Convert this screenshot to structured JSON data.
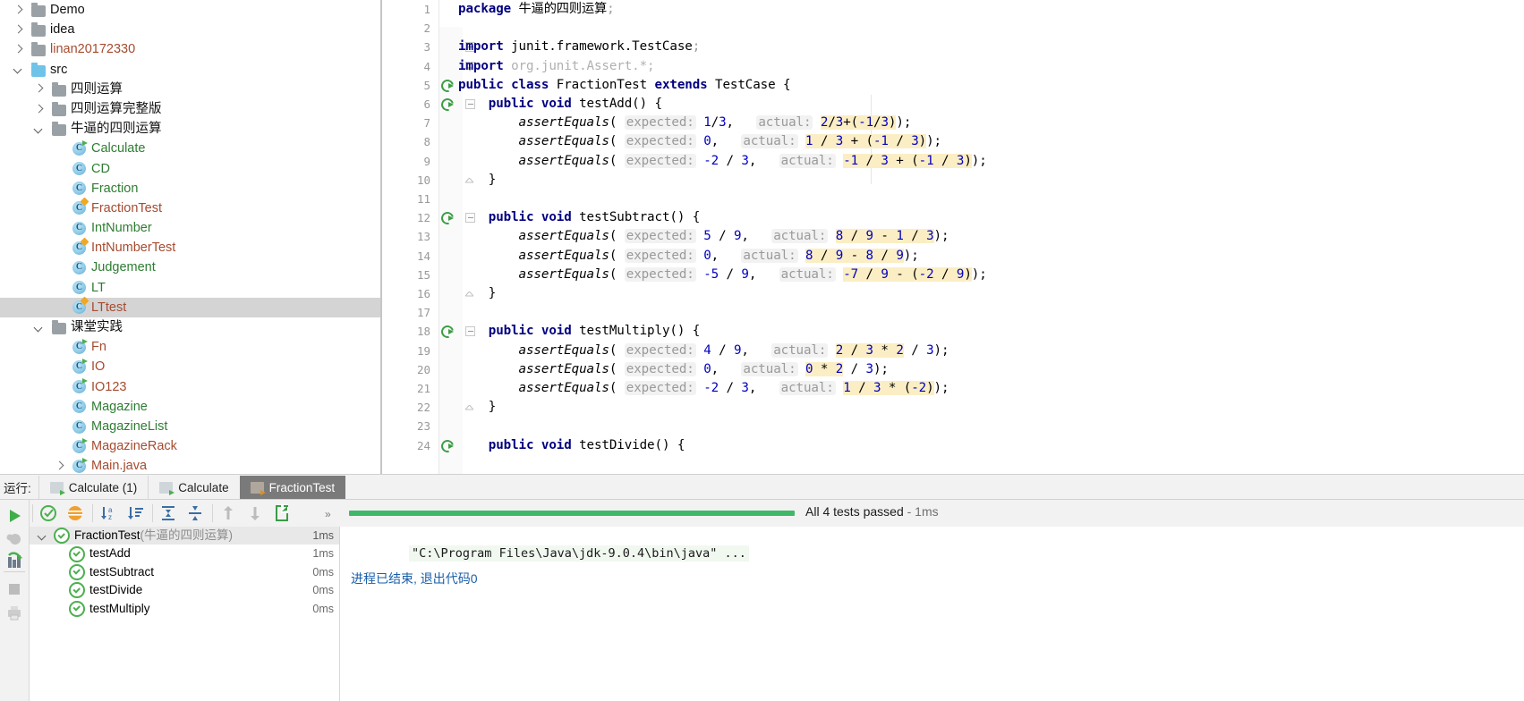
{
  "project_tree": {
    "rows": [
      {
        "indent": 0,
        "twisty": "right",
        "kind": "folder",
        "folder_style": "dark",
        "label": "Demo",
        "color": "black"
      },
      {
        "indent": 0,
        "twisty": "right",
        "kind": "folder",
        "folder_style": "dark",
        "label": "idea",
        "color": "black"
      },
      {
        "indent": 0,
        "twisty": "right",
        "kind": "folder",
        "folder_style": "dark",
        "label": "linan20172330",
        "color": "rust"
      },
      {
        "indent": 0,
        "twisty": "down",
        "kind": "folder",
        "folder_style": "blue",
        "label": "src",
        "color": "black"
      },
      {
        "indent": 1,
        "twisty": "right",
        "kind": "folder",
        "folder_style": "dark",
        "label": "四则运算",
        "color": "black"
      },
      {
        "indent": 1,
        "twisty": "right",
        "kind": "folder",
        "folder_style": "dark",
        "label": "四则运算完整版",
        "color": "black"
      },
      {
        "indent": 1,
        "twisty": "down",
        "kind": "folder",
        "folder_style": "dark",
        "label": "牛逼的四则运算",
        "color": "black"
      },
      {
        "indent": 2,
        "twisty": "none",
        "kind": "class",
        "icon": "class-runnable-icon",
        "label": "Calculate",
        "color": "green"
      },
      {
        "indent": 2,
        "twisty": "none",
        "kind": "class",
        "icon": "class-icon",
        "label": "CD",
        "color": "green"
      },
      {
        "indent": 2,
        "twisty": "none",
        "kind": "class",
        "icon": "class-icon",
        "label": "Fraction",
        "color": "green"
      },
      {
        "indent": 2,
        "twisty": "none",
        "kind": "class",
        "icon": "class-test-icon",
        "label": "FractionTest",
        "color": "rust"
      },
      {
        "indent": 2,
        "twisty": "none",
        "kind": "class",
        "icon": "class-icon",
        "label": "IntNumber",
        "color": "green"
      },
      {
        "indent": 2,
        "twisty": "none",
        "kind": "class",
        "icon": "class-test-icon",
        "label": "IntNumberTest",
        "color": "rust"
      },
      {
        "indent": 2,
        "twisty": "none",
        "kind": "class",
        "icon": "class-icon",
        "label": "Judgement",
        "color": "green"
      },
      {
        "indent": 2,
        "twisty": "none",
        "kind": "class",
        "icon": "class-icon",
        "label": "LT",
        "color": "green"
      },
      {
        "indent": 2,
        "twisty": "none",
        "kind": "class",
        "icon": "class-test-icon",
        "label": "LTtest",
        "color": "rust",
        "selected": true
      },
      {
        "indent": 1,
        "twisty": "down",
        "kind": "folder",
        "folder_style": "dark",
        "label": "课堂实践",
        "color": "black"
      },
      {
        "indent": 2,
        "twisty": "none",
        "kind": "class",
        "icon": "class-runnable-icon",
        "label": "Fn",
        "color": "rust"
      },
      {
        "indent": 2,
        "twisty": "none",
        "kind": "class",
        "icon": "class-runnable-icon",
        "label": "IO",
        "color": "rust"
      },
      {
        "indent": 2,
        "twisty": "none",
        "kind": "class",
        "icon": "class-runnable-icon",
        "label": "IO123",
        "color": "rust"
      },
      {
        "indent": 2,
        "twisty": "none",
        "kind": "class",
        "icon": "class-icon",
        "label": "Magazine",
        "color": "green"
      },
      {
        "indent": 2,
        "twisty": "none",
        "kind": "class",
        "icon": "class-icon",
        "label": "MagazineList",
        "color": "green"
      },
      {
        "indent": 2,
        "twisty": "none",
        "kind": "class",
        "icon": "class-runnable-icon",
        "label": "MagazineRack",
        "color": "rust"
      },
      {
        "indent": 2,
        "twisty": "right",
        "kind": "class",
        "icon": "class-runnable-icon",
        "label": "Main.java",
        "color": "rust"
      }
    ]
  },
  "editor": {
    "lines": [
      {
        "n": "1",
        "html": "<span class=\"kw\">package</span> 牛逼的四则运算<span class=\"gray\">;</span>"
      },
      {
        "n": "2",
        "html": ""
      },
      {
        "n": "3",
        "html": "<span class=\"kw\">import</span> junit.framework.TestCase<span class=\"gray\">;</span>",
        "fold": "top"
      },
      {
        "n": "4",
        "html": "<span class=\"kw\">import</span> <span class=\"faded\">org.junit.Assert.*;</span>",
        "fold": "tail"
      },
      {
        "n": "5",
        "html": "<span class=\"kw\">public class</span> FractionTest <span class=\"kw\">extends</span> TestCase {",
        "run": true
      },
      {
        "n": "6",
        "html": "    <span class=\"kw\">public void</span> testAdd() {",
        "run": true,
        "fold": "top"
      },
      {
        "n": "7",
        "html": "        <span class=\"italic\">assertEquals</span>( <span class=\"param-hint\">expected:</span> <span class=\"num\">1</span>/<span class=\"num\">3</span>,   <span class=\"param-hint\">actual:</span> <span class=\"hl\"><span class=\"num\">2</span>/<span class=\"num\">3</span>+(<span class=\"num\">-1</span>/<span class=\"num\">3</span>)</span>);"
      },
      {
        "n": "8",
        "html": "        <span class=\"italic\">assertEquals</span>( <span class=\"param-hint\">expected:</span> <span class=\"num\">0</span>,   <span class=\"param-hint\">actual:</span> <span class=\"hl\"><span class=\"num\">1</span> / <span class=\"num\">3</span> + (<span class=\"num\">-1</span> / <span class=\"num\">3</span>)</span>);"
      },
      {
        "n": "9",
        "html": "        <span class=\"italic\">assertEquals</span>( <span class=\"param-hint\">expected:</span> <span class=\"num\">-2</span> / <span class=\"num\">3</span>,   <span class=\"param-hint\">actual:</span> <span class=\"hl\"><span class=\"num\">-1</span> / <span class=\"num\">3</span> + (<span class=\"num\">-1</span> / <span class=\"num\">3</span>)</span>);"
      },
      {
        "n": "10",
        "html": "    }",
        "fold": "end"
      },
      {
        "n": "11",
        "html": ""
      },
      {
        "n": "12",
        "html": "    <span class=\"kw\">public void</span> testSubtract() {",
        "run": true,
        "fold": "top"
      },
      {
        "n": "13",
        "html": "        <span class=\"italic\">assertEquals</span>( <span class=\"param-hint\">expected:</span> <span class=\"num\">5</span> / <span class=\"num\">9</span>,   <span class=\"param-hint\">actual:</span> <span class=\"hl\"><span class=\"num\">8</span> / <span class=\"num\">9</span> - <span class=\"num\">1</span> / <span class=\"num\">3</span></span>);"
      },
      {
        "n": "14",
        "html": "        <span class=\"italic\">assertEquals</span>( <span class=\"param-hint\">expected:</span> <span class=\"num\">0</span>,   <span class=\"param-hint\">actual:</span> <span class=\"hl\"><span class=\"num\">8</span> / <span class=\"num\">9</span> - <span class=\"num\">8</span> / <span class=\"num\">9</span></span>);"
      },
      {
        "n": "15",
        "html": "        <span class=\"italic\">assertEquals</span>( <span class=\"param-hint\">expected:</span> <span class=\"num\">-5</span> / <span class=\"num\">9</span>,   <span class=\"param-hint\">actual:</span> <span class=\"hl\"><span class=\"num\">-7</span> / <span class=\"num\">9</span> - (<span class=\"num\">-2</span> / <span class=\"num\">9</span>)</span>);"
      },
      {
        "n": "16",
        "html": "    }",
        "fold": "end"
      },
      {
        "n": "17",
        "html": ""
      },
      {
        "n": "18",
        "html": "    <span class=\"kw\">public void</span> testMultiply() {",
        "run": true,
        "fold": "top"
      },
      {
        "n": "19",
        "html": "        <span class=\"italic\">assertEquals</span>( <span class=\"param-hint\">expected:</span> <span class=\"num\">4</span> / <span class=\"num\">9</span>,   <span class=\"param-hint\">actual:</span> <span class=\"hl\"><span class=\"num\">2</span> / <span class=\"num\">3</span> * <span class=\"num\">2</span></span> / <span class=\"num\">3</span>);"
      },
      {
        "n": "20",
        "html": "        <span class=\"italic\">assertEquals</span>( <span class=\"param-hint\">expected:</span> <span class=\"num\">0</span>,   <span class=\"param-hint\">actual:</span> <span class=\"hl\"><span class=\"num\">0</span> * <span class=\"num\">2</span></span> / <span class=\"num\">3</span>);"
      },
      {
        "n": "21",
        "html": "        <span class=\"italic\">assertEquals</span>( <span class=\"param-hint\">expected:</span> <span class=\"num\">-2</span> / <span class=\"num\">3</span>,   <span class=\"param-hint\">actual:</span> <span class=\"hl\"><span class=\"num\">1</span> / <span class=\"num\">3</span> * (<span class=\"num\">-2</span>)</span>);"
      },
      {
        "n": "22",
        "html": "    }",
        "fold": "end"
      },
      {
        "n": "23",
        "html": ""
      },
      {
        "n": "24",
        "html": "    <span class=\"kw\">public void</span> testDivide() {",
        "run": true
      }
    ]
  },
  "run_panel": {
    "run_label": "运行:",
    "tabs": [
      {
        "label": "Calculate (1)",
        "active": false
      },
      {
        "label": "Calculate",
        "active": false
      },
      {
        "label": "FractionTest",
        "active": true
      }
    ],
    "toolbar_buttons": [
      {
        "name": "rerun-failed-tests-button",
        "icon": "check-circle-icon"
      },
      {
        "name": "toggle-auto-test-button",
        "icon": "stack-icon"
      },
      {
        "name": "sort-alphabetically-button",
        "icon": "sort-az-icon"
      },
      {
        "name": "sort-by-duration-button",
        "icon": "sort-duration-icon"
      },
      {
        "name": "expand-all-button",
        "icon": "expand-all-icon"
      },
      {
        "name": "collapse-all-button",
        "icon": "collapse-all-icon"
      },
      {
        "name": "previous-occurrence-button",
        "icon": "arrow-up-icon"
      },
      {
        "name": "next-occurrence-button",
        "icon": "arrow-down-icon"
      },
      {
        "name": "export-test-results-button",
        "icon": "export-icon"
      },
      {
        "name": "more-options-button",
        "icon": "chevrons-right-icon"
      }
    ],
    "rail_buttons": [
      {
        "name": "rerun-button",
        "icon": "play-icon"
      },
      {
        "name": "debug-button",
        "icon": "bug-icon"
      },
      {
        "name": "rerun-tests-button",
        "icon": "rerun-tests-icon"
      },
      {
        "name": "stop-button",
        "icon": "stop-icon"
      },
      {
        "name": "print-button",
        "icon": "printer-icon"
      }
    ],
    "test_tree": {
      "root": {
        "label": "FractionTest",
        "package": "(牛逼的四则运算)",
        "time": "1ms",
        "status": "passed",
        "expanded": true
      },
      "tests": [
        {
          "label": "testAdd",
          "time": "1ms",
          "status": "passed"
        },
        {
          "label": "testSubtract",
          "time": "0ms",
          "status": "passed"
        },
        {
          "label": "testDivide",
          "time": "0ms",
          "status": "passed"
        },
        {
          "label": "testMultiply",
          "time": "0ms",
          "status": "passed"
        }
      ]
    },
    "status": {
      "summary": "All 4 tests passed",
      "duration": "- 1ms",
      "progress_percent": 100,
      "progress_color": "#3fb868"
    },
    "console": {
      "command_line": "\"C:\\Program Files\\Java\\jdk-9.0.4\\bin\\java\" ...",
      "exit_line": "进程已结束, 退出代码0"
    }
  }
}
